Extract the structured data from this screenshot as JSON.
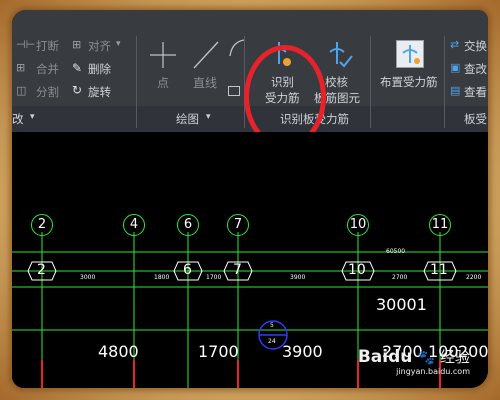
{
  "ribbon": {
    "modify": {
      "break": "打断",
      "align": "对齐",
      "merge": "合并",
      "delete": "删除",
      "split": "分割",
      "rotate": "旋转",
      "group_title": "改"
    },
    "draw": {
      "point": "点",
      "line": "直线",
      "group_title": "绘图"
    },
    "identify": {
      "identify_rebar_line1": "识别",
      "identify_rebar_line2": "受力筋",
      "check_line1": "校核",
      "check_line2": "板筋图元",
      "group_title": "识别板受力筋"
    },
    "place": {
      "place_rebar": "布置受力筋"
    },
    "view": {
      "cross": "交换",
      "view1": "查改",
      "view2": "查看",
      "group_title": "板受"
    }
  },
  "drawing": {
    "axis_circles": [
      "2",
      "4",
      "6",
      "7",
      "10",
      "11"
    ],
    "axis_hex_labels": [
      "2",
      "6",
      "7",
      "10",
      "11"
    ],
    "top_dim": "60500",
    "small_dims": [
      "3000",
      "1800",
      "1700",
      "3900",
      "2700",
      "2200"
    ],
    "large_dims": [
      "4800",
      "1700",
      "3900",
      "2700",
      "100",
      "200"
    ],
    "total_dim": "30001",
    "marker_top": "5",
    "marker_bottom": "24"
  },
  "watermark": {
    "brand": "Baidu",
    "brand_cn": "经验",
    "url": "jingyan.baidu.com"
  }
}
